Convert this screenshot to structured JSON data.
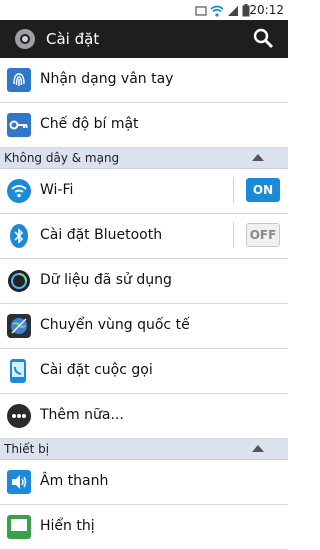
{
  "status_bar": {
    "time": "20:12"
  },
  "action_bar": {
    "title": "Cài đặt"
  },
  "items": [
    {
      "label": "Nhận dạng vân tay",
      "icon": "fingerprint-icon"
    },
    {
      "label": "Chế độ bí mật",
      "icon": "key-icon"
    }
  ],
  "sections": [
    {
      "title": "Không dây & mạng",
      "items": [
        {
          "label": "Wi-Fi",
          "icon": "wifi-icon",
          "toggle": "ON"
        },
        {
          "label": "Cài đặt Bluetooth",
          "icon": "bluetooth-icon",
          "toggle": "OFF"
        },
        {
          "label": "Dữ liệu đã sử dụng",
          "icon": "data-usage-icon"
        },
        {
          "label": "Chuyển vùng quốc tế",
          "icon": "globe-icon"
        },
        {
          "label": "Cài đặt cuộc gọi",
          "icon": "phone-icon"
        },
        {
          "label": "Thêm nữa...",
          "icon": "more-icon"
        }
      ]
    },
    {
      "title": "Thiết bị",
      "items": [
        {
          "label": "Âm thanh",
          "icon": "sound-icon"
        },
        {
          "label": "Hiển thị",
          "icon": "display-icon"
        }
      ]
    }
  ],
  "colors": {
    "accent": "#1b8ad8",
    "section_bg": "#d9e2ed",
    "action_bar": "#1e1e1e"
  }
}
